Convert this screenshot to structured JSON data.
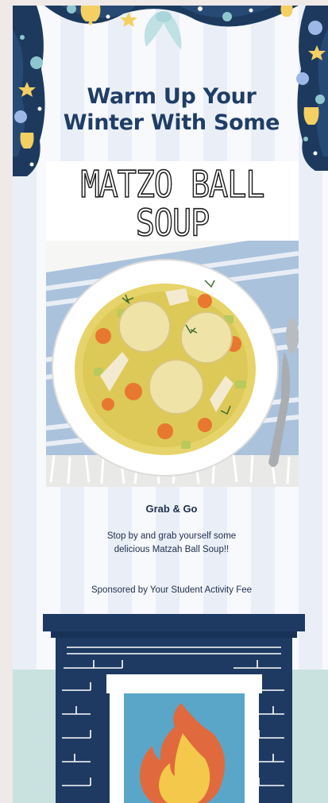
{
  "headline": {
    "line1": "Warm Up Your",
    "line2": "Winter With Some"
  },
  "poster": {
    "title_line1": "MATZO BALL",
    "title_line2": "SOUP"
  },
  "content": {
    "subhead": "Grab & Go",
    "body": "Stop by and grab yourself some delicious Matzah Ball Soup!!",
    "sponsor": "Sponsored by Your Student Activity Fee"
  },
  "colors": {
    "navy": "#1f3d66",
    "stripe_light": "#f7f9fd",
    "stripe_dark": "#eaeff7",
    "floor": "#c9e2df",
    "fire_blue": "#5aa6c9",
    "flame_orange": "#e06a3e",
    "flame_yellow": "#f3c84b"
  },
  "icons": [
    "garland-icon",
    "bell-icon",
    "star-icon",
    "bow-icon",
    "ornament-icon",
    "fireplace-icon",
    "flame-icon",
    "soup-bowl-icon"
  ]
}
